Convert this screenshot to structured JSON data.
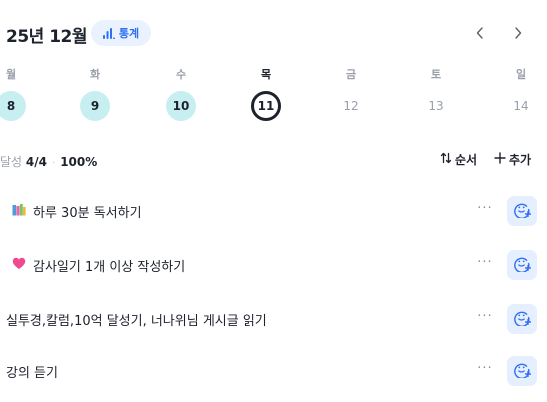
{
  "header": {
    "month_title": "25년 12월",
    "stats_label": "통계",
    "prev_icon": "chevron-left-icon",
    "next_icon": "chevron-right-icon"
  },
  "week": {
    "days": [
      {
        "weekday": "월",
        "date": "8",
        "state": "done"
      },
      {
        "weekday": "화",
        "date": "9",
        "state": "done"
      },
      {
        "weekday": "수",
        "date": "10",
        "state": "done"
      },
      {
        "weekday": "목",
        "date": "11",
        "state": "today"
      },
      {
        "weekday": "금",
        "date": "12",
        "state": "future"
      },
      {
        "weekday": "토",
        "date": "13",
        "state": "future"
      },
      {
        "weekday": "일",
        "date": "14",
        "state": "future"
      }
    ]
  },
  "summary": {
    "label": "달성",
    "count": "4/4",
    "percent": "100%",
    "sort_label": "순서",
    "add_label": "추가"
  },
  "tasks": [
    {
      "title": "하루 30분 독서하기",
      "icon": "books-icon"
    },
    {
      "title": "감사일기 1개 이상 작성하기",
      "icon": "heart-icon"
    },
    {
      "title": "실투경,칼럼,10억 달성기, 너나위님 게시글 읽기",
      "icon": ""
    },
    {
      "title": "강의 듣기",
      "icon": ""
    }
  ],
  "colors": {
    "accent": "#2f6ff1",
    "done_circle": "#c7eff2",
    "emoji_button_bg": "#e5efff",
    "muted_text": "#9aa0ab"
  }
}
